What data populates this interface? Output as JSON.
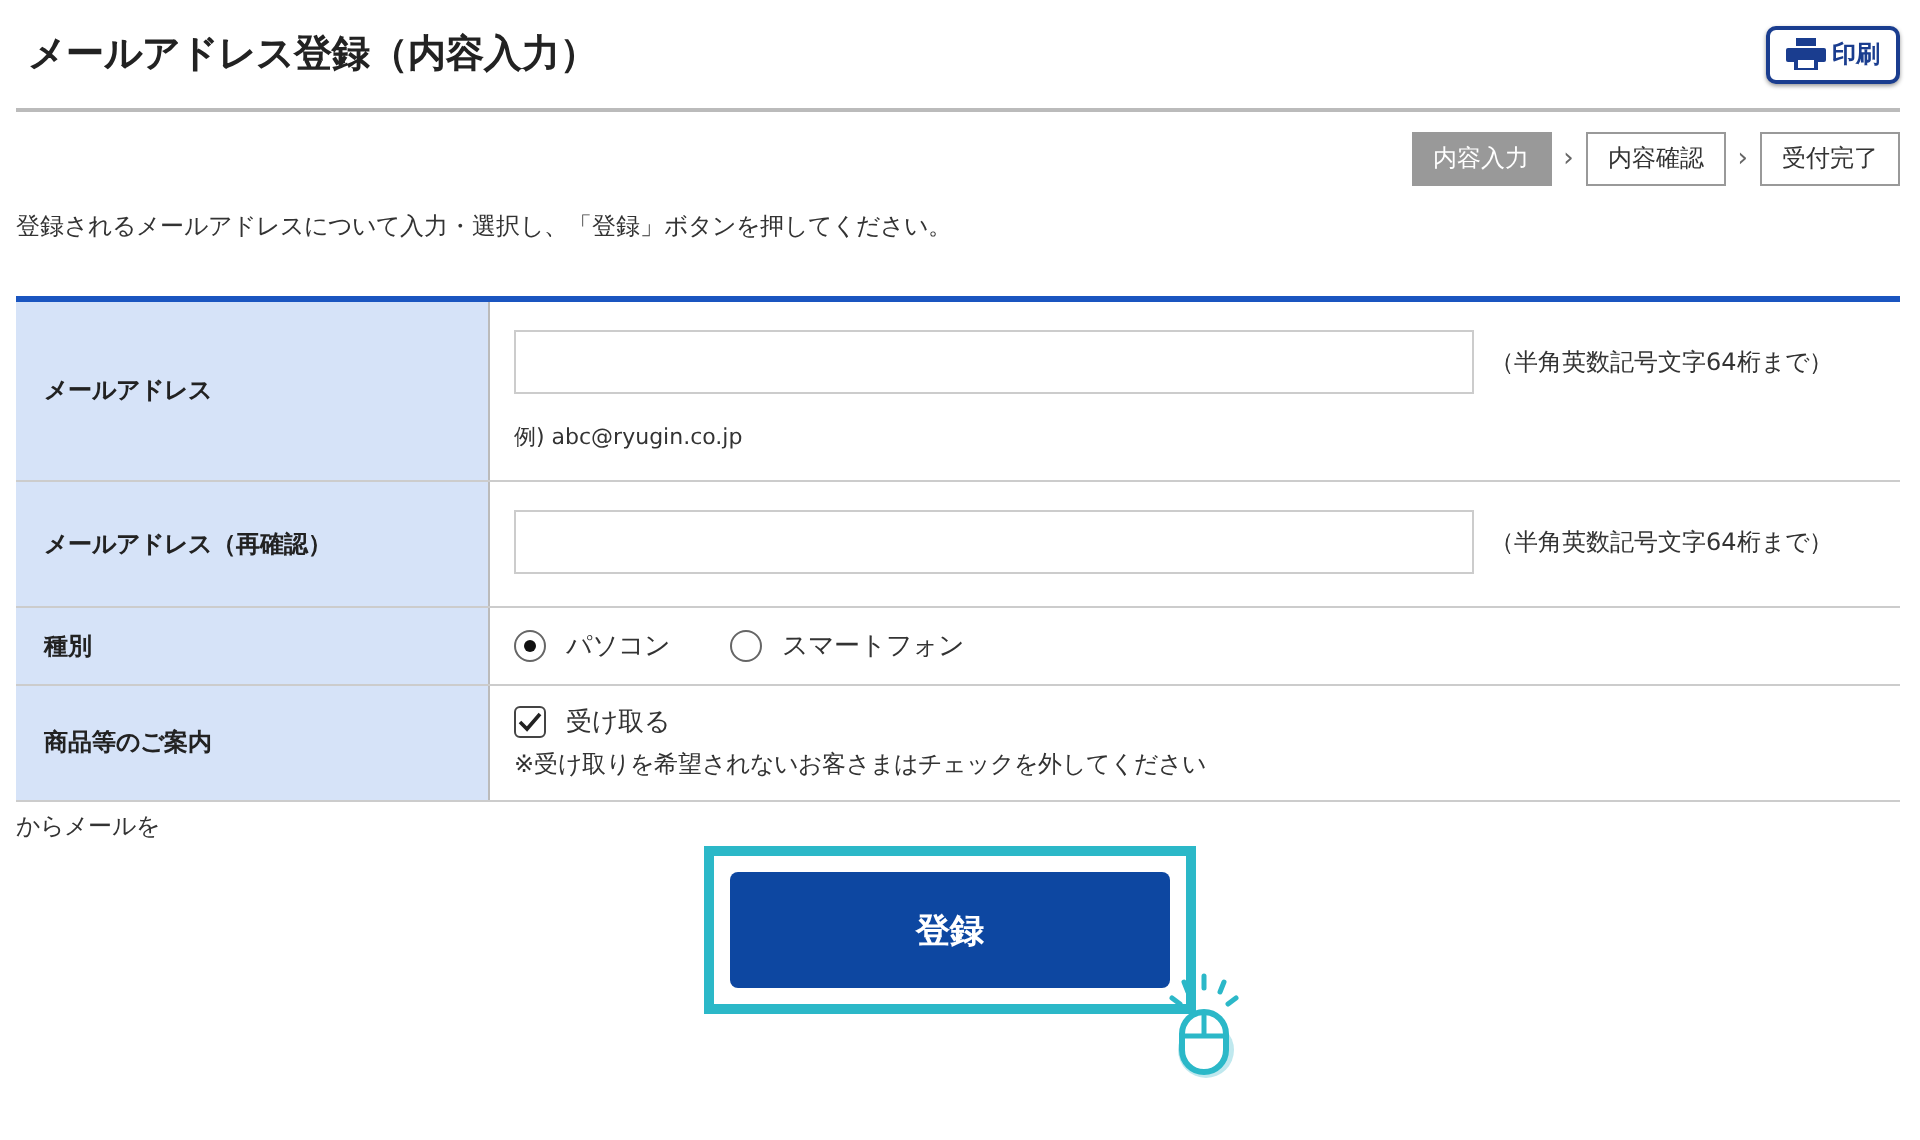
{
  "header": {
    "title": "メールアドレス登録（内容入力）",
    "print_button": "印刷"
  },
  "steps": [
    {
      "label": "内容入力",
      "selected": true
    },
    {
      "label": "内容確認",
      "selected": false
    },
    {
      "label": "受付完了",
      "selected": false
    }
  ],
  "step_separator": "›",
  "instruction": "登録されるメールアドレスについて入力・選択し、「登録」ボタンを押してください。",
  "form": [
    {
      "kind": "input",
      "label": "メールアドレス",
      "note": "（半角英数記号文字64桁まで）",
      "example": "例) abc@ryugin.co.jp"
    },
    {
      "kind": "input",
      "label": "メールアドレス（再確認）",
      "note": "（半角英数記号文字64桁まで）"
    },
    {
      "kind": "radio",
      "label": "種別",
      "options": [
        {
          "label": "パソコン",
          "selected": true
        },
        {
          "label": "スマートフォン",
          "selected": false
        }
      ]
    },
    {
      "kind": "checkbox",
      "label": "商品等のご案内",
      "option": "受け取る",
      "checked": true,
      "note": "※受け取りを希望されないお客さまはチェックを外してください"
    }
  ],
  "partial_text": "からメールを",
  "submit_button": "登録"
}
